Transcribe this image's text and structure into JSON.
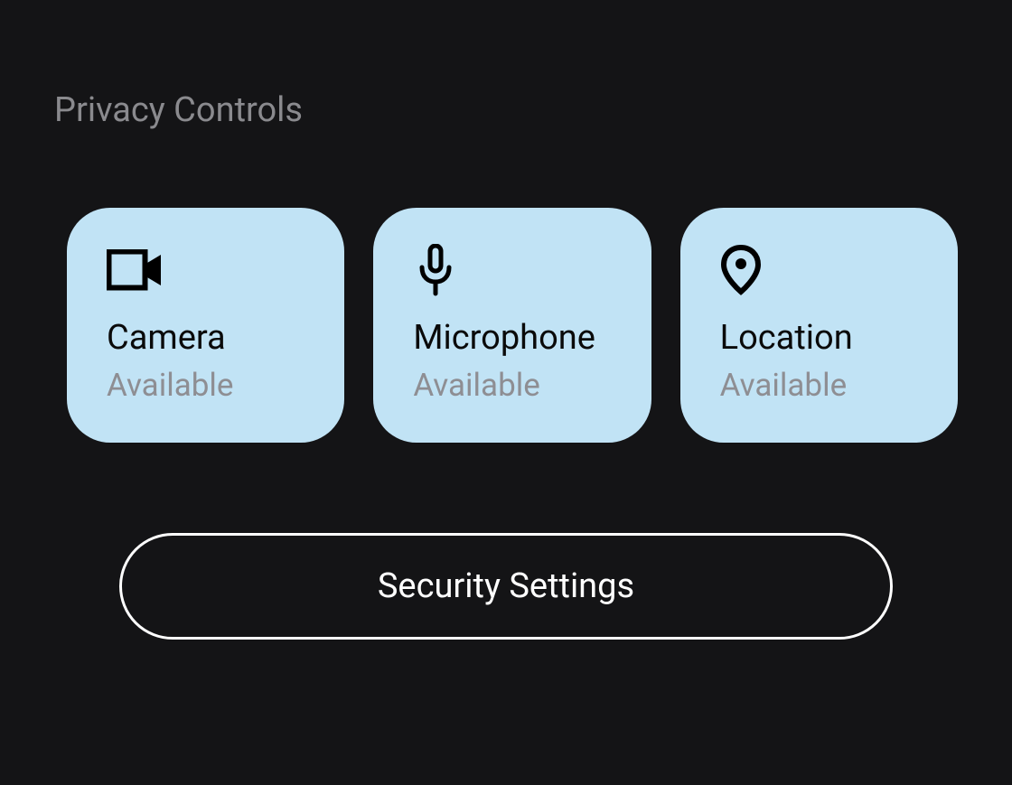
{
  "section": {
    "title": "Privacy Controls"
  },
  "tiles": [
    {
      "icon": "camera",
      "label": "Camera",
      "status": "Available"
    },
    {
      "icon": "microphone",
      "label": "Microphone",
      "status": "Available"
    },
    {
      "icon": "location",
      "label": "Location",
      "status": "Available"
    }
  ],
  "buttons": {
    "security_settings": "Security Settings"
  },
  "colors": {
    "background": "#141416",
    "tile_background": "#c1e3f5",
    "title_text": "#8a8a8e",
    "label_text": "#0a0a0a",
    "status_text": "#8e8e93",
    "button_border": "#ffffff"
  }
}
